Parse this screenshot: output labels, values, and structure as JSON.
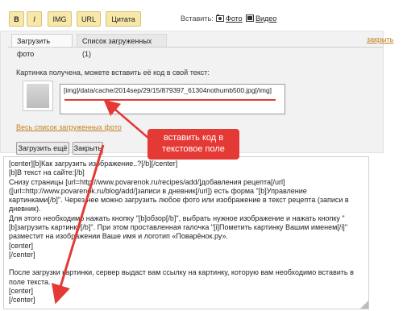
{
  "toolbar": {
    "bold_label": "B",
    "italic_label": "I",
    "img_label": "IMG",
    "url_label": "URL",
    "quote_label": "Цитата",
    "insert_label": "Вставить:",
    "photo_link": "Фото",
    "video_link": "Видео"
  },
  "tabs": [
    {
      "label": "Загрузить фото",
      "active": true
    },
    {
      "label": "Список загруженных (1)",
      "active": false
    }
  ],
  "close_link": "закрыть",
  "upload": {
    "message": "Картинка получена, можете вставить её код в свой текст:",
    "image_code": "[img]/data/cache/2014sep/29/15/879397_61304nothumb500.jpg[/img]",
    "all_list_link": "Весь список загруженных фото",
    "upload_more_button": "Загрузить ещё",
    "close_button": "Закрыть"
  },
  "callout": {
    "line1": "вставить код в",
    "line2": "текстовое поле"
  },
  "editor": {
    "lines": [
      "[center][b]Как загрузить изображение..?[/b][/center]",
      "[b]В текст на сайте:[/b]",
      "Снизу страницы [url=http://www.povarenok.ru/recipes/add/]добавления рецепта[/url]",
      "([url=http://www.povarenok.ru/blog/add/]записи в дневник[/url]) есть форма \"[b]Управление",
      "картинками[/b]\". Через нее можно загрузить любое фото или изображение в текст рецепта (записи в",
      "дневник).",
      "Для этого необходимо нажать кнопку \"[b]обзор[/b]\", выбрать нужное изображение и нажать кнопку \"",
      "[b]загрузить картинку[/b]\". При этом проставленная галочка \"[i]Пометить картинку Вашим именем[/i]\"",
      "разместит на изображении Ваше имя и логотип «Поварёнок.ру».",
      "[center]",
      "[/center]",
      "",
      "После загрузки картинки, сервер выдаст вам ссылку на картинку, которую вам необходимо вставить в",
      "поле текста.",
      "[center]",
      "[/center]"
    ]
  },
  "colors": {
    "toolbar_button": "#f7e7a8",
    "link_orange": "#c08020",
    "annotation_red": "#e53935"
  },
  "icons": {
    "photo": "photo-icon",
    "video": "video-icon"
  }
}
